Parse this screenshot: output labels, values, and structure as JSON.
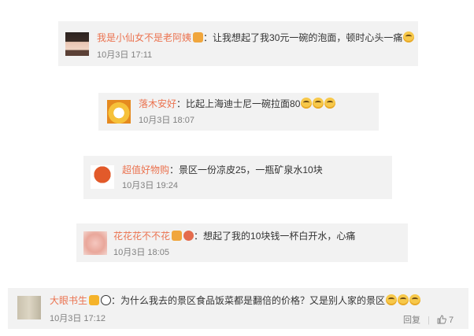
{
  "comments": [
    {
      "user": "我是小仙女不是老阿姨",
      "text": "：让我想起了我30元一碗的泡面，顿时心头一痛",
      "time": "10月3日  17:11"
    },
    {
      "user": "落木安好",
      "text": "：比起上海迪士尼一碗拉面80",
      "time": "10月3日  18:07"
    },
    {
      "user": "超值好物购",
      "text": "：景区一份凉皮25，一瓶矿泉水10块",
      "time": "10月3日  19:24"
    },
    {
      "user": "花花花不不花",
      "text": "：想起了我的10块钱一杯白开水，心痛",
      "time": "10月3日  18:05"
    },
    {
      "user": "大眼书生",
      "text": "：为什么我去的景区食品饭菜都是翻倍的价格？又是别人家的景区",
      "time": "10月3日  17:12",
      "reply_label": "回复",
      "like_count": "7"
    }
  ],
  "colors": {
    "username": "#eb7350",
    "card_bg": "#f2f2f2",
    "time": "#808080"
  },
  "icons": [
    "laugh-cry-emoji-icon",
    "vip-badge-icon",
    "panda-badge-icon",
    "thumbs-up-icon"
  ]
}
